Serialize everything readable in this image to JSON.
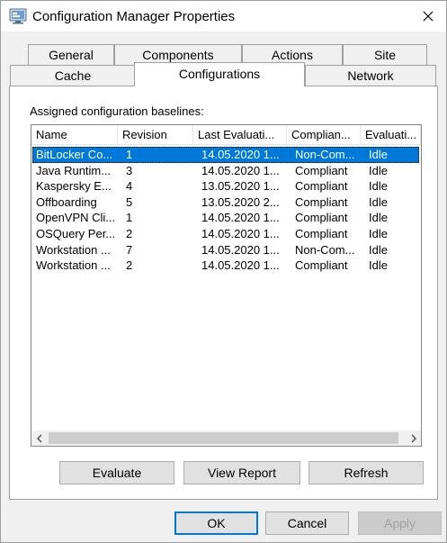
{
  "window": {
    "title": "Configuration Manager Properties"
  },
  "icons": {
    "app": "configuration-manager-icon",
    "close": "close-icon",
    "scroll_left": "chevron-left-icon",
    "scroll_right": "chevron-right-icon"
  },
  "tabs": {
    "back_row": [
      "General",
      "Components",
      "Actions",
      "Site"
    ],
    "front_row": [
      "Cache",
      "Configurations",
      "Network"
    ],
    "selected": "Configurations"
  },
  "panel": {
    "caption": "Assigned configuration baselines:"
  },
  "list": {
    "columns": [
      "Name",
      "Revision",
      "Last Evaluati...",
      "Complian...",
      "Evaluati..."
    ],
    "rows": [
      [
        "BitLocker Co...",
        "1",
        "14.05.2020 1...",
        "Non-Com...",
        "Idle"
      ],
      [
        "Java Runtim...",
        "3",
        "14.05.2020 1...",
        "Compliant",
        "Idle"
      ],
      [
        "Kaspersky E...",
        "4",
        "13.05.2020 1...",
        "Compliant",
        "Idle"
      ],
      [
        "Offboarding",
        "5",
        "13.05.2020 2...",
        "Compliant",
        "Idle"
      ],
      [
        "OpenVPN Cli...",
        "1",
        "14.05.2020 1...",
        "Compliant",
        "Idle"
      ],
      [
        "OSQuery Per...",
        "2",
        "14.05.2020 1...",
        "Compliant",
        "Idle"
      ],
      [
        "Workstation ...",
        "7",
        "14.05.2020 1...",
        "Non-Com...",
        "Idle"
      ],
      [
        "Workstation ...",
        "2",
        "14.05.2020 1...",
        "Compliant",
        "Idle"
      ]
    ],
    "selected_row": 0
  },
  "panel_buttons": {
    "evaluate": "Evaluate",
    "view_report": "View Report",
    "refresh": "Refresh"
  },
  "dialog_buttons": {
    "ok": "OK",
    "cancel": "Cancel",
    "apply": "Apply",
    "apply_enabled": false
  },
  "colors": {
    "selection": "#0078d7",
    "dialog_bg": "#f0f0f0",
    "button_bg": "#e1e1e1"
  }
}
